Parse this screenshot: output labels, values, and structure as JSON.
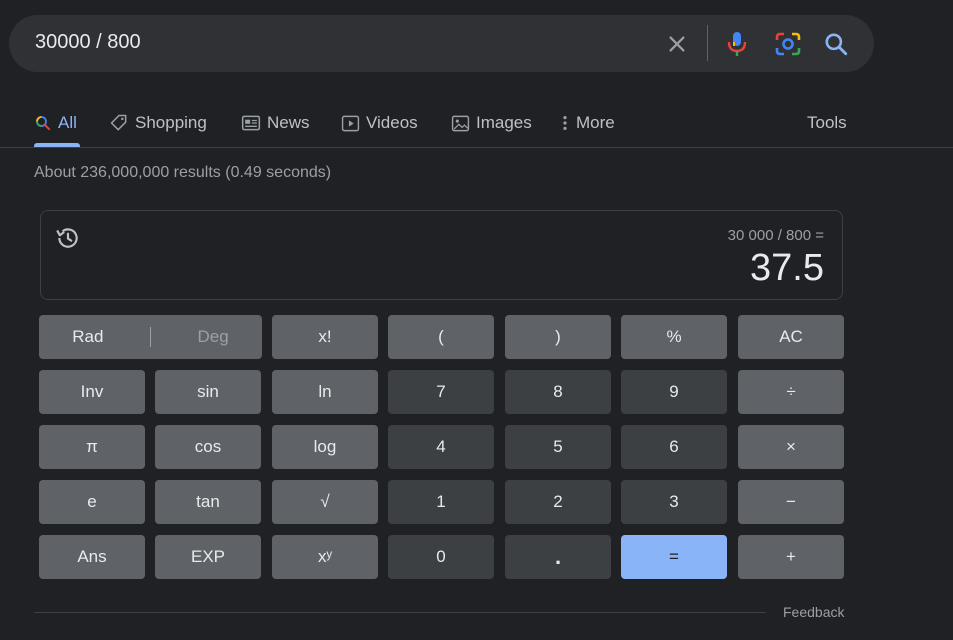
{
  "search": {
    "query": "30000 / 800",
    "icons": [
      "close-icon",
      "mic-icon",
      "lens-icon",
      "search-icon"
    ]
  },
  "tabs": [
    {
      "label": "All",
      "icon": "search-icon",
      "active": true
    },
    {
      "label": "Shopping",
      "icon": "tag-icon"
    },
    {
      "label": "News",
      "icon": "news-icon"
    },
    {
      "label": "Videos",
      "icon": "play-icon"
    },
    {
      "label": "Images",
      "icon": "image-icon"
    },
    {
      "label": "More",
      "icon": "more-vert-icon"
    }
  ],
  "tools_label": "Tools",
  "result_stats": "About 236,000,000 results (0.49 seconds)",
  "calculator": {
    "expression": "30 000 / 800 =",
    "result": "37.5",
    "rad_label": "Rad",
    "deg_label": "Deg",
    "keys": [
      {
        "label": "x!"
      },
      {
        "label": "("
      },
      {
        "label": ")"
      },
      {
        "label": "%"
      },
      {
        "label": "AC"
      },
      {
        "label": "Inv"
      },
      {
        "label": "sin"
      },
      {
        "label": "ln"
      },
      {
        "label": "7"
      },
      {
        "label": "8"
      },
      {
        "label": "9"
      },
      {
        "label": "÷"
      },
      {
        "label": "π"
      },
      {
        "label": "cos"
      },
      {
        "label": "log"
      },
      {
        "label": "4"
      },
      {
        "label": "5"
      },
      {
        "label": "6"
      },
      {
        "label": "×"
      },
      {
        "label": "e"
      },
      {
        "label": "tan"
      },
      {
        "label": "√"
      },
      {
        "label": "1"
      },
      {
        "label": "2"
      },
      {
        "label": "3"
      },
      {
        "label": "−"
      },
      {
        "label": "Ans"
      },
      {
        "label": "EXP"
      },
      {
        "label": "xʸ"
      },
      {
        "label": "0"
      },
      {
        "label": "."
      },
      {
        "label": "="
      },
      {
        "label": "+"
      }
    ]
  },
  "feedback_label": "Feedback",
  "colors": {
    "background": "#202124",
    "accent": "#8ab4f8",
    "function_key": "#5f6368",
    "number_key": "#3c4043"
  }
}
